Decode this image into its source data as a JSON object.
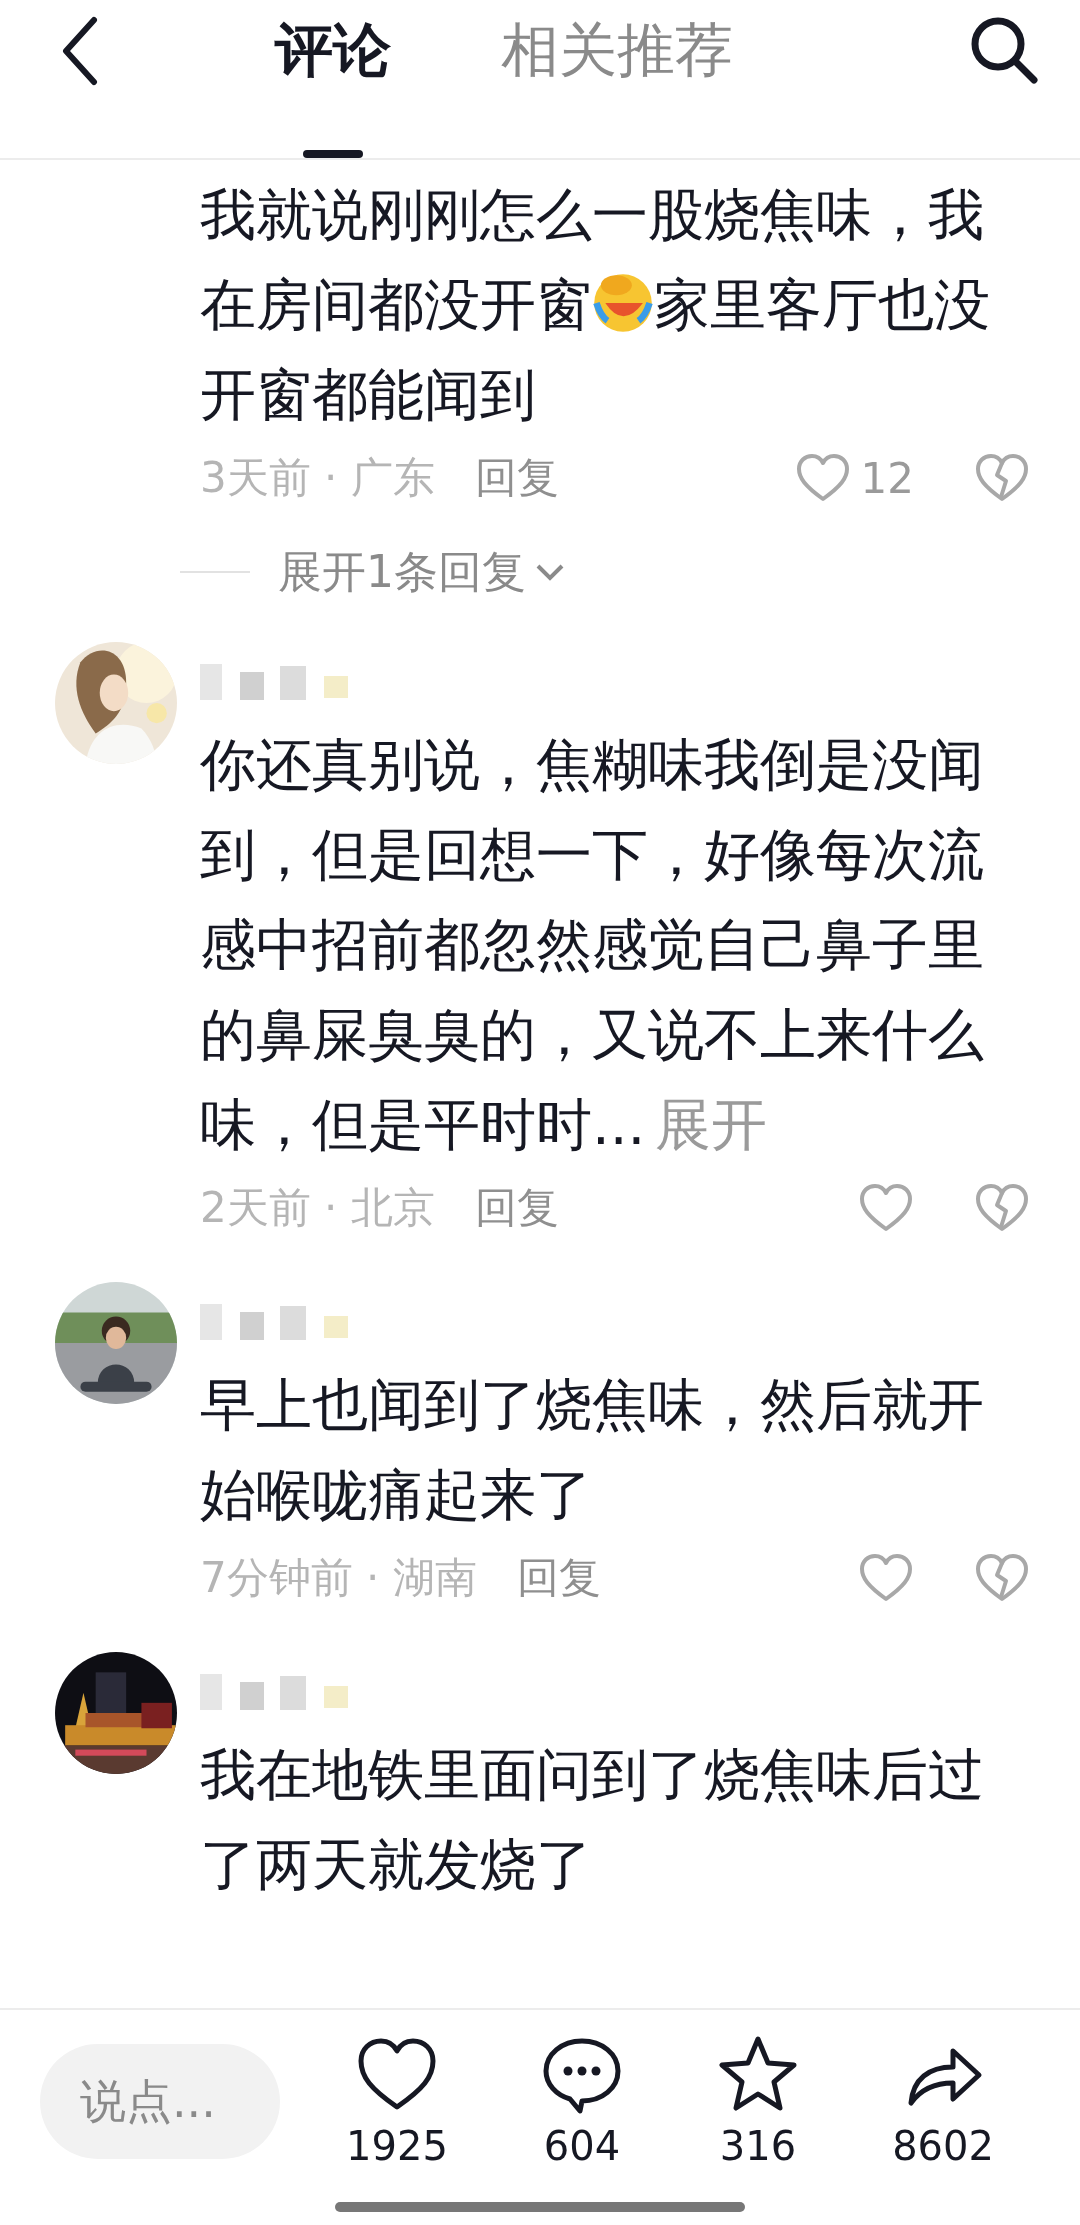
{
  "header": {
    "tabs": [
      {
        "label": "评论",
        "selected": true
      },
      {
        "label": "相关推荐",
        "selected": false
      }
    ]
  },
  "comments": [
    {
      "masked_name": false,
      "parts": [
        {
          "kind": "text",
          "text": "我就说刚刚怎么一股烧焦味，我在房间都没开窗"
        },
        {
          "kind": "emoji"
        },
        {
          "kind": "text",
          "text": "家里客厅也没开窗都能闻到"
        }
      ],
      "time_location": "3天前 · 广东",
      "reply": "回复",
      "likes": "12",
      "expand_replies": "展开1条回复"
    },
    {
      "avatar": {
        "kind": "picture"
      },
      "masked_name": true,
      "parts": [
        {
          "kind": "text",
          "text": "你还真别说，焦糊味我倒是没闻到，但是回想一下，好像每次流感中招前都忽然感觉自己鼻子里的鼻屎臭臭的，又说不上来什么味，但是平时时..."
        }
      ],
      "more": "展开",
      "time_location": "2天前 · 北京",
      "reply": "回复"
    },
    {
      "avatar": {
        "kind": "picture"
      },
      "masked_name": true,
      "parts": [
        {
          "kind": "text",
          "text": "早上也闻到了烧焦味，然后就开始喉咙痛起来了"
        }
      ],
      "time_location": "7分钟前 · 湖南",
      "reply": "回复"
    },
    {
      "avatar": {
        "kind": "picture"
      },
      "masked_name": true,
      "parts": [
        {
          "kind": "text",
          "text": "我在地铁里面问到了烧焦味后过了两天就发烧了"
        }
      ]
    }
  ],
  "bottom_bar": {
    "input": {
      "placeholder": "说点..."
    },
    "actions": [
      {
        "kind": "like",
        "count": "1925"
      },
      {
        "kind": "comment",
        "count": "604"
      },
      {
        "kind": "favorite",
        "count": "316"
      },
      {
        "kind": "share",
        "count": "8602"
      }
    ]
  }
}
